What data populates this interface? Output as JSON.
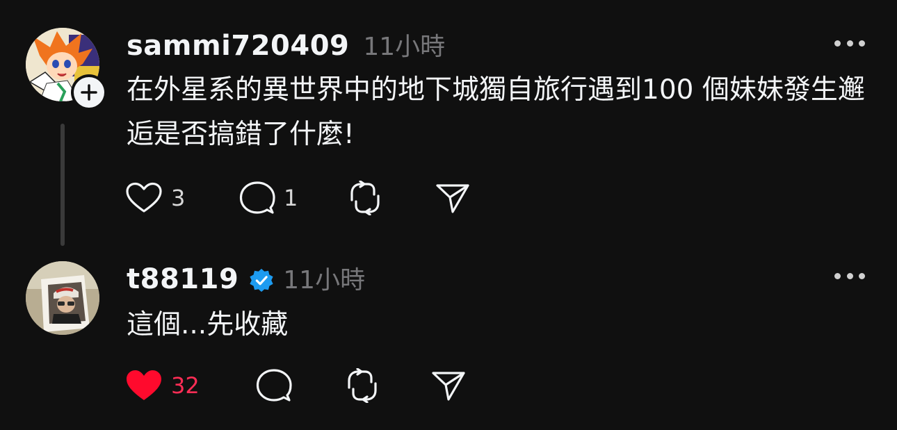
{
  "posts": [
    {
      "username": "sammi720409",
      "time": "11小時",
      "text": "在外星系的異世界中的地下城獨自旅行遇到100 個妹妹發生邂逅是否搞錯了什麼!",
      "likes": "3",
      "replies": "1",
      "liked": false,
      "avatar_icon": "anime-avatar",
      "has_follow_button": true
    },
    {
      "username": "t88119",
      "verified": true,
      "time": "11小時",
      "text": "這個...先收藏",
      "likes": "32",
      "liked": true,
      "avatar_icon": "photo-avatar"
    }
  ],
  "colors": {
    "background": "#101010",
    "text": "#f3f5f7",
    "secondary": "#77777a",
    "like_active": "#ff2d55",
    "verified": "#1d9bf0"
  }
}
